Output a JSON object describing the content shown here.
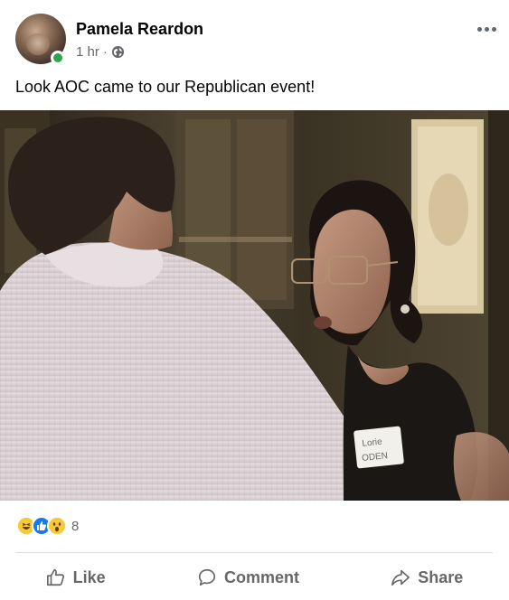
{
  "post": {
    "author": "Pamela Reardon",
    "timestamp": "1 hr",
    "separator": "·",
    "privacy_icon": "globe-icon",
    "text": "Look AOC came to our Republican event!"
  },
  "reactions": {
    "types": [
      "haha",
      "like",
      "wow"
    ],
    "count": "8"
  },
  "actions": {
    "like": "Like",
    "comment": "Comment",
    "share": "Share"
  },
  "photo": {
    "badge_text": [
      "Lorie",
      "ODEN"
    ]
  },
  "colors": {
    "online": "#31a24c",
    "like_blue": "#1877f2",
    "meta_gray": "#65676b"
  }
}
